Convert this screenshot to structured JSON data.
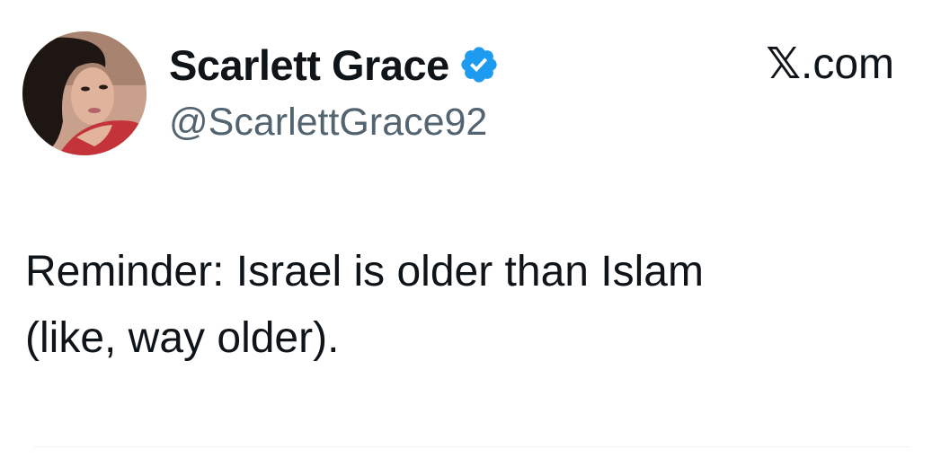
{
  "author": {
    "display_name": "Scarlett Grace",
    "handle": "@ScarlettGrace92",
    "verified": true,
    "avatar_icon": "profile-photo"
  },
  "site": {
    "logo_icon": "x-logo-icon",
    "logo_char": "𝕏",
    "label": ".com"
  },
  "tweet": {
    "line1": "Reminder: Israel is older than Islam",
    "line2": "(like, way older)."
  },
  "colors": {
    "verified_blue": "#1d9bf0",
    "handle_gray": "#536471",
    "text": "#0f1419"
  }
}
